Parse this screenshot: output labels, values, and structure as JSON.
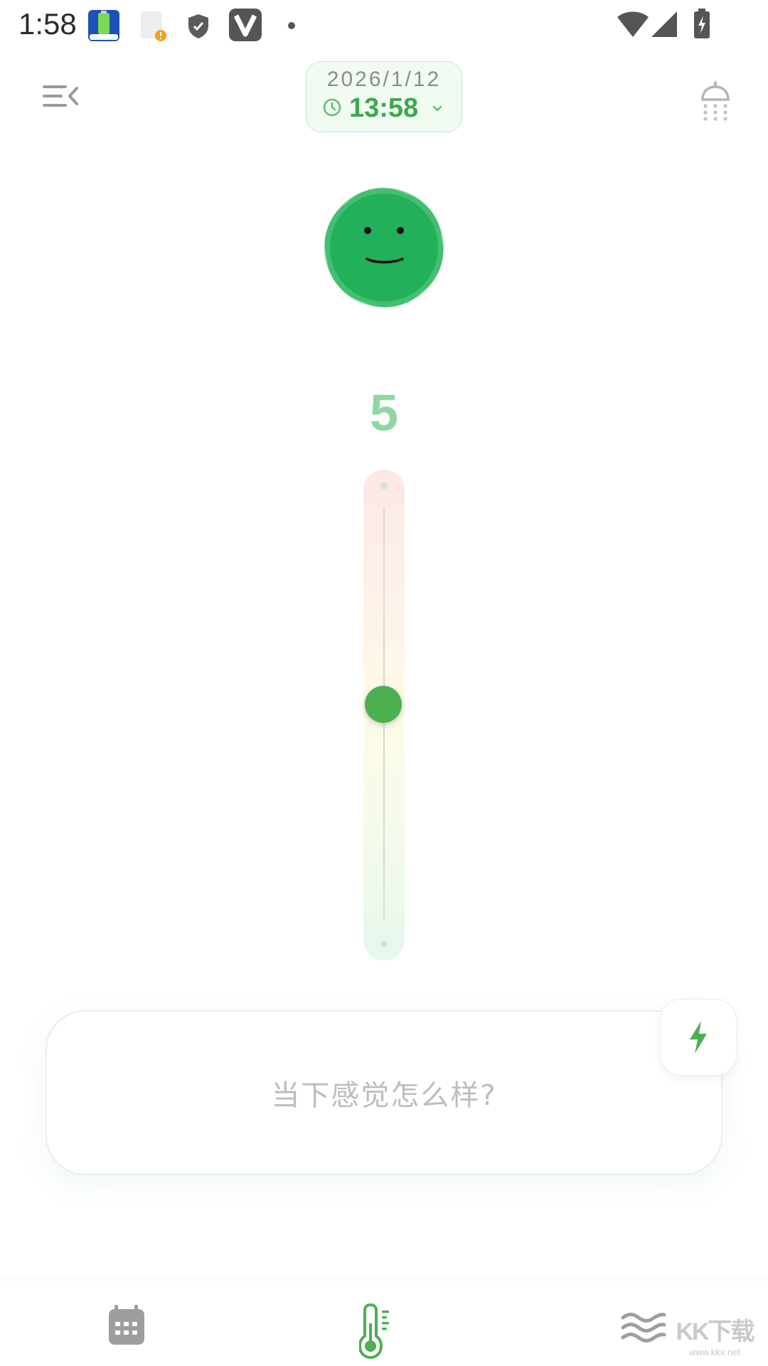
{
  "status_bar": {
    "time": "1:58",
    "notification_icons": [
      "battery-app-icon",
      "notification-alert-icon",
      "shield-icon",
      "v-app-icon",
      "dot-icon"
    ],
    "system_icons": [
      "wifi-icon",
      "cell-signal-icon",
      "battery-charging-icon"
    ]
  },
  "header": {
    "date": "2026/1/12",
    "time": "13:58",
    "left_icon": "menu-collapse-icon",
    "right_icon": "shower-icon",
    "accent_color": "#3aaa4a"
  },
  "mood": {
    "face_icon": "smiley-face-icon",
    "score": "5",
    "slider_level": 0.5,
    "face_color": "#22b05a"
  },
  "input": {
    "placeholder": "当下感觉怎么样?",
    "quick_button_icon": "lightning-icon"
  },
  "bottom_nav": {
    "items": [
      {
        "icon": "calendar-icon",
        "active": false
      },
      {
        "icon": "thermometer-icon",
        "active": true
      },
      {
        "icon": "waves-icon",
        "active": false
      }
    ]
  },
  "watermark": {
    "text": "KK下载",
    "url": "www.kkx.net"
  }
}
